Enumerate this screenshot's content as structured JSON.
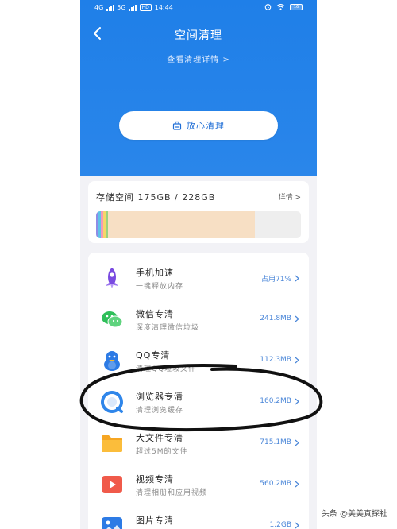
{
  "status_bar": {
    "network1": "4G",
    "network2": "5G",
    "hd_badge": "HD",
    "time": "14:44",
    "battery": "16"
  },
  "header": {
    "title": "空间清理",
    "detail_link": "查看清理详情 >"
  },
  "clean_button": {
    "label": "放心清理"
  },
  "storage": {
    "label": "存储空间 175GB / 228GB",
    "detail": "详情 >",
    "segments": [
      {
        "color": "#8f8ce6",
        "fraction": 0.012
      },
      {
        "color": "#5ec3e8",
        "fraction": 0.012
      },
      {
        "color": "#f29ab8",
        "fraction": 0.012
      },
      {
        "color": "#f6d56a",
        "fraction": 0.012
      },
      {
        "color": "#9bd37f",
        "fraction": 0.012
      },
      {
        "color": "#f7dfc4",
        "fraction": 0.715
      }
    ]
  },
  "items": [
    {
      "title": "手机加速",
      "subtitle": "一键释放内存",
      "value": "占用71%",
      "icon": "rocket-icon",
      "color": "#7a4be0"
    },
    {
      "title": "微信专清",
      "subtitle": "深度清理微信垃圾",
      "value": "241.8MB",
      "icon": "wechat-icon",
      "color": "#2fbf5a"
    },
    {
      "title": "QQ专清",
      "subtitle": "清理QQ垃圾文件",
      "value": "112.3MB",
      "icon": "qq-icon",
      "color": "#2d7be5"
    },
    {
      "title": "浏览器专清",
      "subtitle": "清理浏览缓存",
      "value": "160.2MB",
      "icon": "browser-icon",
      "color": "#2f86ea"
    },
    {
      "title": "大文件专清",
      "subtitle": "超过5M的文件",
      "value": "715.1MB",
      "icon": "folder-icon",
      "color": "#f6a623"
    },
    {
      "title": "视频专清",
      "subtitle": "清理相册和应用视频",
      "value": "560.2MB",
      "icon": "video-icon",
      "color": "#f05a4a"
    },
    {
      "title": "图片专清",
      "subtitle": "",
      "value": "1.2GB",
      "icon": "image-icon",
      "color": "#2d7be5"
    }
  ],
  "watermark": "头条 @美美真探社"
}
